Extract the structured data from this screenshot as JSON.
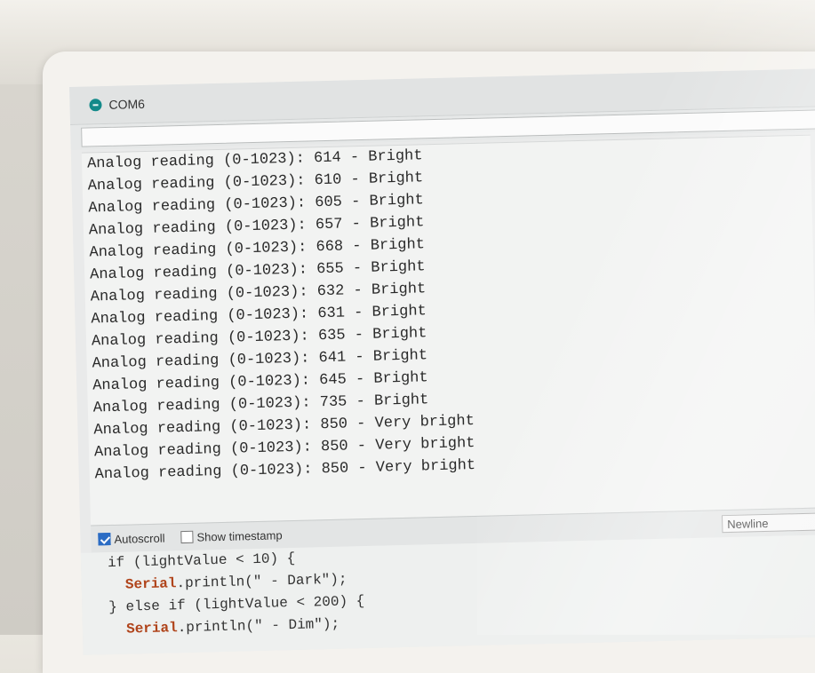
{
  "window": {
    "title": "COM6"
  },
  "serial_input": {
    "value": ""
  },
  "output_lines": [
    "Analog reading (0-1023): 614 - Bright",
    "Analog reading (0-1023): 610 - Bright",
    "Analog reading (0-1023): 605 - Bright",
    "Analog reading (0-1023): 657 - Bright",
    "Analog reading (0-1023): 668 - Bright",
    "Analog reading (0-1023): 655 - Bright",
    "Analog reading (0-1023): 632 - Bright",
    "Analog reading (0-1023): 631 - Bright",
    "Analog reading (0-1023): 635 - Bright",
    "Analog reading (0-1023): 641 - Bright",
    "Analog reading (0-1023): 645 - Bright",
    "Analog reading (0-1023): 735 - Bright",
    "Analog reading (0-1023): 850 - Very bright",
    "Analog reading (0-1023): 850 - Very bright",
    "Analog reading (0-1023): 850 - Very bright"
  ],
  "footer": {
    "autoscroll_label": "Autoscroll",
    "autoscroll_checked": true,
    "timestamp_label": "Show timestamp",
    "timestamp_checked": false,
    "line_ending": "Newline"
  },
  "code": {
    "line1": "if (lightValue < 10) {",
    "line2_obj": "Serial",
    "line2_rest": ".println(\" - Dark\");",
    "line3": "} else if (lightValue < 200) {",
    "line4_obj": "Serial",
    "line4_rest": ".println(\" - Dim\");"
  },
  "colors": {
    "accent": "#2b6cc4",
    "app_icon": "#138a8a"
  }
}
